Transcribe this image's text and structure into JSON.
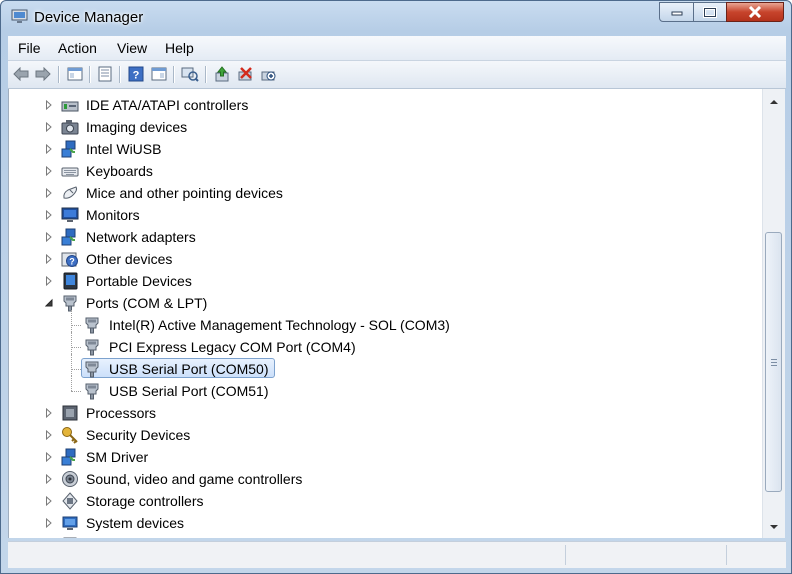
{
  "window": {
    "title": "Device Manager"
  },
  "menu": [
    "File",
    "Action",
    "View",
    "Help"
  ],
  "toolbar": [
    "back",
    "forward",
    "show-hide-console-tree",
    "properties",
    "help",
    "show-action-pane",
    "scan-hardware",
    "update-driver",
    "uninstall",
    "disable"
  ],
  "tree": {
    "items": [
      {
        "label": "IDE ATA/ATAPI controllers",
        "icon": "ide-controller-icon",
        "level": 0,
        "expander": "collapsed"
      },
      {
        "label": "Imaging devices",
        "icon": "camera-icon",
        "level": 0,
        "expander": "collapsed"
      },
      {
        "label": "Intel WiUSB",
        "icon": "network-icon",
        "level": 0,
        "expander": "collapsed"
      },
      {
        "label": "Keyboards",
        "icon": "keyboard-icon",
        "level": 0,
        "expander": "collapsed"
      },
      {
        "label": "Mice and other pointing devices",
        "icon": "mouse-icon",
        "level": 0,
        "expander": "collapsed"
      },
      {
        "label": "Monitors",
        "icon": "monitor-icon",
        "level": 0,
        "expander": "collapsed"
      },
      {
        "label": "Network adapters",
        "icon": "network-icon",
        "level": 0,
        "expander": "collapsed"
      },
      {
        "label": "Other devices",
        "icon": "unknown-device-icon",
        "level": 0,
        "expander": "collapsed"
      },
      {
        "label": "Portable Devices",
        "icon": "portable-device-icon",
        "level": 0,
        "expander": "collapsed"
      },
      {
        "label": "Ports (COM & LPT)",
        "icon": "port-icon",
        "level": 0,
        "expander": "expanded"
      },
      {
        "label": "Intel(R) Active Management Technology - SOL (COM3)",
        "icon": "port-icon",
        "level": 1,
        "expander": "none"
      },
      {
        "label": "PCI Express Legacy COM Port (COM4)",
        "icon": "port-icon",
        "level": 1,
        "expander": "none"
      },
      {
        "label": "USB Serial Port (COM50)",
        "icon": "port-icon",
        "level": 1,
        "expander": "none",
        "selected": true
      },
      {
        "label": "USB Serial Port (COM51)",
        "icon": "port-icon",
        "level": 1,
        "expander": "none"
      },
      {
        "label": "Processors",
        "icon": "processor-icon",
        "level": 0,
        "expander": "collapsed"
      },
      {
        "label": "Security Devices",
        "icon": "key-icon",
        "level": 0,
        "expander": "collapsed"
      },
      {
        "label": "SM Driver",
        "icon": "network-icon",
        "level": 0,
        "expander": "collapsed"
      },
      {
        "label": "Sound, video and game controllers",
        "icon": "speaker-icon",
        "level": 0,
        "expander": "collapsed"
      },
      {
        "label": "Storage controllers",
        "icon": "storage-icon",
        "level": 0,
        "expander": "collapsed"
      },
      {
        "label": "System devices",
        "icon": "system-icon",
        "level": 0,
        "expander": "collapsed"
      }
    ]
  },
  "colors": {
    "selection": "#cce0fa",
    "selection_border": "#7da2ce",
    "frame": "#b6cde6"
  }
}
